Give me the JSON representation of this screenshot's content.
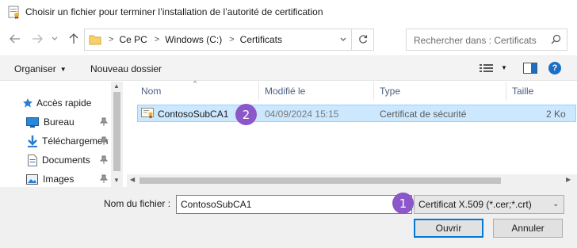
{
  "window": {
    "title": "Choisir un fichier pour terminer l’installation de l’autorité de certification"
  },
  "nav": {
    "breadcrumb": [
      "Ce PC",
      "Windows (C:)",
      "Certificats"
    ],
    "search_placeholder": "Rechercher dans : Certificats"
  },
  "toolbar": {
    "organize_label": "Organiser",
    "new_folder_label": "Nouveau dossier"
  },
  "sidebar": {
    "items": [
      {
        "label": "Accès rapide",
        "icon": "star-icon",
        "pinned": false
      },
      {
        "label": "Bureau",
        "icon": "desktop-icon",
        "pinned": true
      },
      {
        "label": "Téléchargements",
        "icon": "download-icon",
        "pinned": true
      },
      {
        "label": "Documents",
        "icon": "document-icon",
        "pinned": true
      },
      {
        "label": "Images",
        "icon": "image-icon",
        "pinned": true
      }
    ]
  },
  "file_list": {
    "columns": [
      "Nom",
      "Modifié le",
      "Type",
      "Taille"
    ],
    "rows": [
      {
        "name": "ContosoSubCA1",
        "modified": "04/09/2024 15:15",
        "type": "Certificat de sécurité",
        "size": "2 Ko",
        "selected": true
      }
    ]
  },
  "footer": {
    "filename_label": "Nom du fichier :",
    "filename_value": "ContosoSubCA1",
    "filter_value": "Certificat X.509 (*.cer;*.crt)",
    "open_label": "Ouvrir",
    "cancel_label": "Annuler"
  },
  "callouts": {
    "badge1": "1",
    "badge2": "2"
  },
  "colors": {
    "accent": "#0078d7",
    "selection": "#cce8ff",
    "badge": "#8c57c9"
  }
}
